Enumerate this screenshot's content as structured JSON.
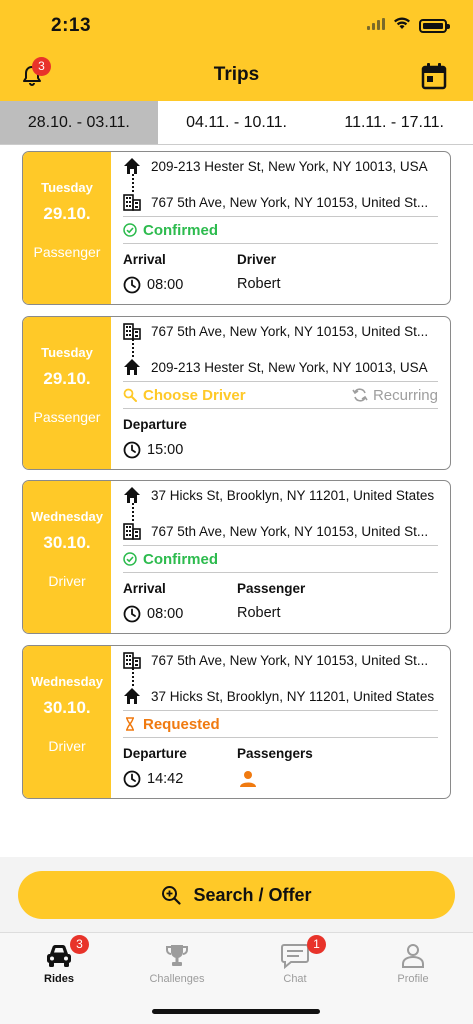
{
  "status_bar": {
    "time": "2:13"
  },
  "header": {
    "title": "Trips",
    "notification_count": "3"
  },
  "week_tabs": [
    {
      "label": "28.10. - 03.11.",
      "active": true
    },
    {
      "label": "04.11. - 10.11.",
      "active": false
    },
    {
      "label": "11.11. - 17.11.",
      "active": false
    }
  ],
  "trips": [
    {
      "day": "Tuesday",
      "date": "29.10.",
      "role": "Passenger",
      "from": {
        "icon": "home-icon",
        "address": "209-213 Hester St, New York, NY 10013, USA"
      },
      "to": {
        "icon": "building-icon",
        "address": "767 5th Ave, New York, NY 10153, United St..."
      },
      "status": "Confirmed",
      "status_color": "#2DBB4E",
      "time_label": "Arrival",
      "time": "08:00",
      "person_label": "Driver",
      "person": "Robert"
    },
    {
      "day": "Tuesday",
      "date": "29.10.",
      "role": "Passenger",
      "from": {
        "icon": "building-icon",
        "address": "767 5th Ave, New York, NY 10153, United St..."
      },
      "to": {
        "icon": "home-icon",
        "address": "209-213 Hester St, New York, NY 10013, USA"
      },
      "status": "Choose Driver",
      "status_color": "#FFC928",
      "recurring": "Recurring",
      "time_label": "Departure",
      "time": "15:00"
    },
    {
      "day": "Wednesday",
      "date": "30.10.",
      "role": "Driver",
      "from": {
        "icon": "home-icon",
        "address": "37 Hicks St, Brooklyn, NY 11201, United States"
      },
      "to": {
        "icon": "building-icon",
        "address": "767 5th Ave, New York, NY 10153, United St..."
      },
      "status": "Confirmed",
      "status_color": "#2DBB4E",
      "time_label": "Arrival",
      "time": "08:00",
      "person_label": "Passenger",
      "person": "Robert"
    },
    {
      "day": "Wednesday",
      "date": "30.10.",
      "role": "Driver",
      "from": {
        "icon": "building-icon",
        "address": "767 5th Ave, New York, NY 10153, United St..."
      },
      "to": {
        "icon": "home-icon",
        "address": "37 Hicks St, Brooklyn, NY 11201, United States"
      },
      "status": "Requested",
      "status_color": "#F07A10",
      "time_label": "Departure",
      "time": "14:42",
      "person_label": "Passengers"
    }
  ],
  "search_button": {
    "label": "Search / Offer"
  },
  "tab_bar": [
    {
      "label": "Rides",
      "icon": "car-icon",
      "badge": "3",
      "active": true
    },
    {
      "label": "Challenges",
      "icon": "trophy-icon",
      "active": false
    },
    {
      "label": "Chat",
      "icon": "chat-icon",
      "badge": "1",
      "active": false
    },
    {
      "label": "Profile",
      "icon": "profile-icon",
      "active": false
    }
  ],
  "colors": {
    "accent": "#FFC928",
    "badge": "#E8332A"
  }
}
